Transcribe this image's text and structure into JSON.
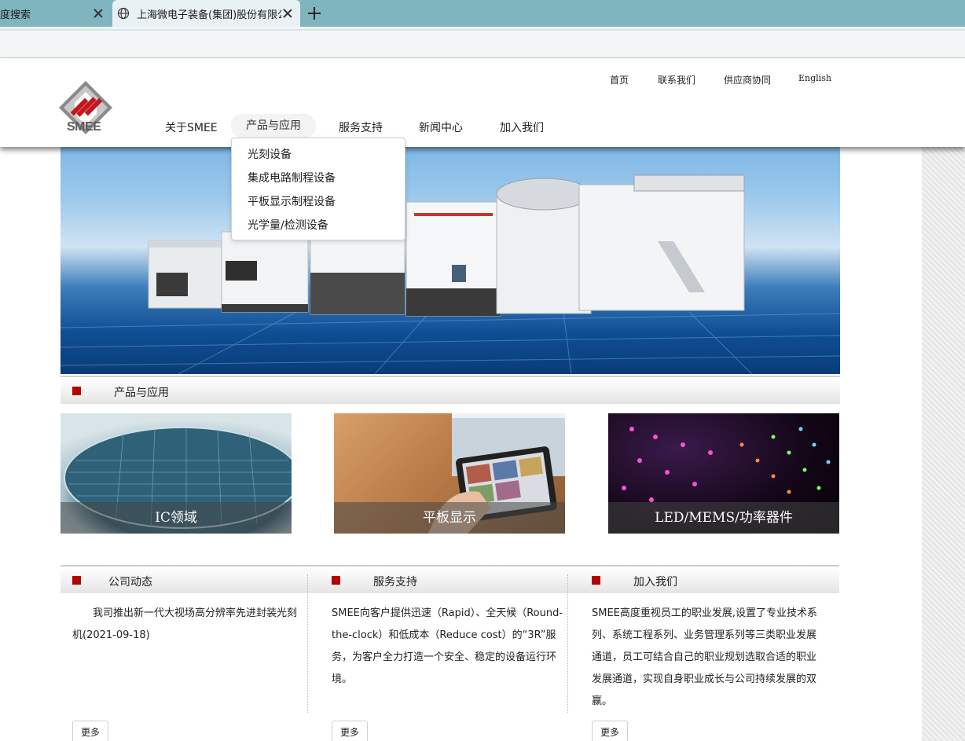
{
  "browser": {
    "tabs": [
      {
        "title": "度搜索"
      },
      {
        "title": "上海微电子装备(集团)股份有限公司"
      }
    ]
  },
  "site": {
    "logo_text": "SMEE",
    "top_nav": [
      "首页",
      "联系我们",
      "供应商协同",
      "English"
    ],
    "main_nav": [
      "关于SMEE",
      "产品与应用",
      "服务支持",
      "新闻中心",
      "加入我们"
    ],
    "active_nav": "产品与应用",
    "dropdown": [
      "光刻设备",
      "集成电路制程设备",
      "平板显示制程设备",
      "光学量/检测设备"
    ]
  },
  "products": {
    "title": "产品与应用",
    "tiles": [
      {
        "caption": "IC领域"
      },
      {
        "caption": "平板显示"
      },
      {
        "caption": "LED/MEMS/功率器件"
      }
    ]
  },
  "columns": [
    {
      "title": "公司动态",
      "text": "　　我司推出新一代大视场高分辨率先进封装光刻机(2021-09-18)",
      "more": "更多"
    },
    {
      "title": "服务支持",
      "text": "SMEE向客户提供迅速（Rapid）、全天候（Round-the-clock）和低成本（Reduce cost）的“3R”服务，为客户全力打造一个安全、稳定的设备运行环境。",
      "more": "更多"
    },
    {
      "title": "加入我们",
      "text": "SMEE高度重视员工的职业发展,设置了专业技术系列、系统工程系列、业务管理系列等三类职业发展通道，员工可结合自己的职业规划选取合适的职业发展通道，实现自身职业成长与公司持续发展的双赢。",
      "more": "更多"
    }
  ],
  "colors": {
    "brand_red": "#b30000",
    "tab_bar": "#7fb5bf"
  }
}
